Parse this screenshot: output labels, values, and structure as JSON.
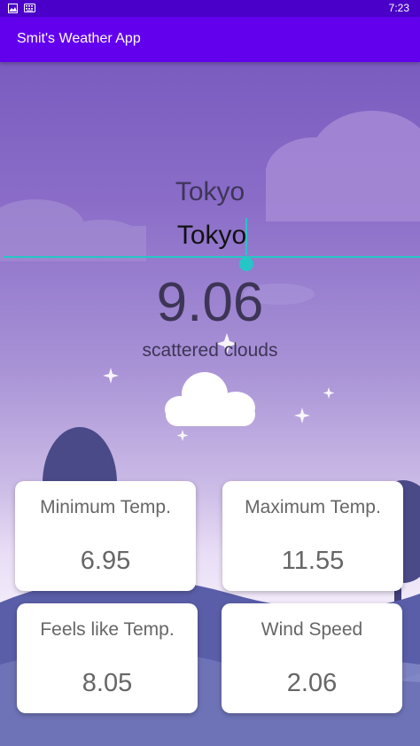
{
  "status_bar": {
    "time": "7:23",
    "icons": [
      "image-icon",
      "keyboard-icon"
    ]
  },
  "app_bar": {
    "title": "Smit's Weather App"
  },
  "city": {
    "label": "Tokyo",
    "input_value": "Tokyo"
  },
  "weather": {
    "temperature": "9.06",
    "description": "scattered clouds"
  },
  "cards": {
    "min_temp": {
      "label": "Minimum Temp.",
      "value": "6.95"
    },
    "max_temp": {
      "label": "Maximum Temp.",
      "value": "11.55"
    },
    "feels_like": {
      "label": "Feels like Temp.",
      "value": "8.05"
    },
    "wind_speed": {
      "label": "Wind Speed",
      "value": "2.06"
    }
  },
  "colors": {
    "app_bar": "#6200ee",
    "status_bar": "#4a00c8",
    "accent": "#26c6c6"
  }
}
